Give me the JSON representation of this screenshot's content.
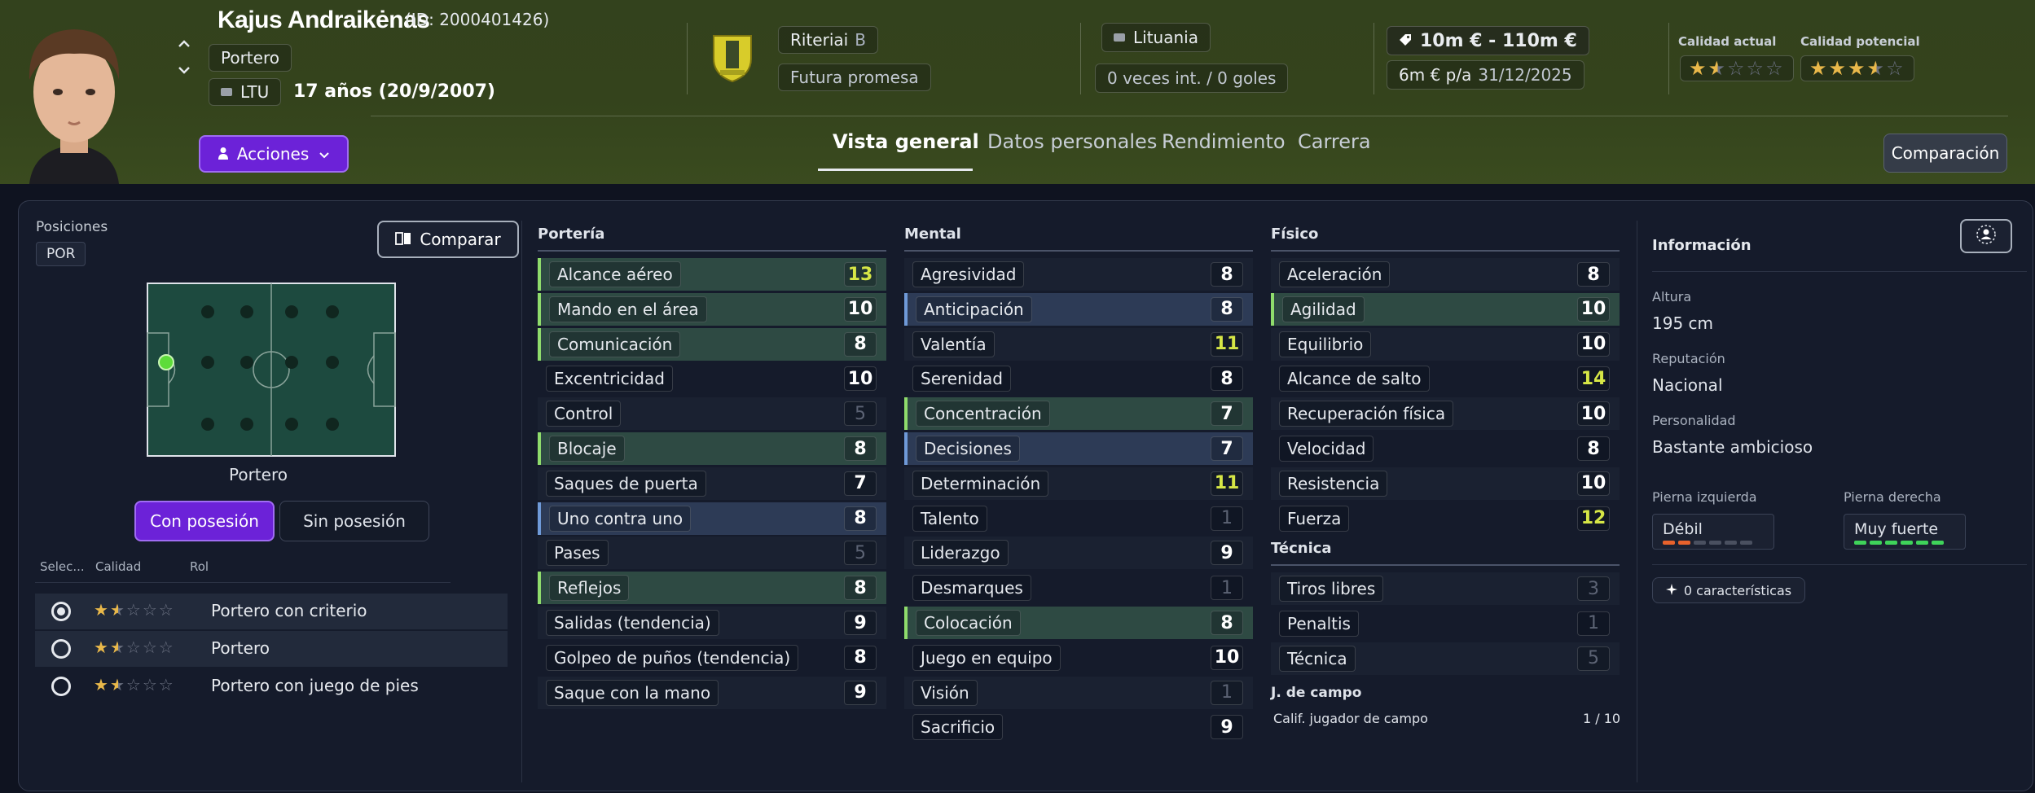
{
  "player": {
    "name": "Kajus Andraikėnas",
    "id": "(ID: 2000401426)",
    "position": "Portero",
    "nation_code": "LTU",
    "age": "17 años (20/9/2007)"
  },
  "club": {
    "name": "Riteriai",
    "team": "B",
    "status": "Futura promesa"
  },
  "nation": {
    "name": "Lituania",
    "caps": "0 veces int. / 0 goles"
  },
  "value": {
    "range": "10m € - 110m €",
    "wage": "6m € p/a",
    "contract_end": "31/12/2025"
  },
  "quality": {
    "current_label": "Calidad actual",
    "potential_label": "Calidad potencial",
    "current_stars": 1.5,
    "potential_stars": 3.5,
    "star_color": "#e9b84a"
  },
  "actions_label": "Acciones",
  "tabs": [
    "Vista general",
    "Datos personales",
    "Rendimiento",
    "Carrera"
  ],
  "compare_label": "Comparación",
  "positions": {
    "title": "Posiciones",
    "code": "POR",
    "compare_button": "Comparar",
    "pitch_caption": "Portero",
    "toggle_on": "Con posesión",
    "toggle_off": "Sin posesión"
  },
  "roles": {
    "headers": [
      "Selec...",
      "Calidad",
      "Rol"
    ],
    "items": [
      {
        "name": "Portero con criterio",
        "stars": 1.5,
        "selected": true
      },
      {
        "name": "Portero",
        "stars": 1.5,
        "selected": false
      },
      {
        "name": "Portero con juego de pies",
        "stars": 1.5,
        "selected": false
      }
    ]
  },
  "porteria": {
    "title": "Portería",
    "attrs": [
      {
        "name": "Alcance aéreo",
        "value": "13",
        "hl": "green",
        "tone": "hi"
      },
      {
        "name": "Mando en el área",
        "value": "10",
        "hl": "green",
        "tone": "normal"
      },
      {
        "name": "Comunicación",
        "value": "8",
        "hl": "green",
        "tone": "normal"
      },
      {
        "name": "Excentricidad",
        "value": "10",
        "hl": "none",
        "tone": "normal"
      },
      {
        "name": "Control",
        "value": "5",
        "hl": "none",
        "tone": "dim"
      },
      {
        "name": "Blocaje",
        "value": "8",
        "hl": "green",
        "tone": "normal"
      },
      {
        "name": "Saques de puerta",
        "value": "7",
        "hl": "none",
        "tone": "normal"
      },
      {
        "name": "Uno contra uno",
        "value": "8",
        "hl": "blue",
        "tone": "normal"
      },
      {
        "name": "Pases",
        "value": "5",
        "hl": "none",
        "tone": "dim"
      },
      {
        "name": "Reflejos",
        "value": "8",
        "hl": "green",
        "tone": "normal"
      },
      {
        "name": "Salidas (tendencia)",
        "value": "9",
        "hl": "none",
        "tone": "normal"
      },
      {
        "name": "Golpeo de puños (tendencia)",
        "value": "8",
        "hl": "none",
        "tone": "normal"
      },
      {
        "name": "Saque con la mano",
        "value": "9",
        "hl": "none",
        "tone": "normal"
      }
    ]
  },
  "mental": {
    "title": "Mental",
    "attrs": [
      {
        "name": "Agresividad",
        "value": "8",
        "hl": "none",
        "tone": "normal"
      },
      {
        "name": "Anticipación",
        "value": "8",
        "hl": "blue",
        "tone": "normal"
      },
      {
        "name": "Valentía",
        "value": "11",
        "hl": "none",
        "tone": "hi"
      },
      {
        "name": "Serenidad",
        "value": "8",
        "hl": "none",
        "tone": "normal"
      },
      {
        "name": "Concentración",
        "value": "7",
        "hl": "green",
        "tone": "normal"
      },
      {
        "name": "Decisiones",
        "value": "7",
        "hl": "blue",
        "tone": "normal"
      },
      {
        "name": "Determinación",
        "value": "11",
        "hl": "none",
        "tone": "hi"
      },
      {
        "name": "Talento",
        "value": "1",
        "hl": "none",
        "tone": "dim"
      },
      {
        "name": "Liderazgo",
        "value": "9",
        "hl": "none",
        "tone": "normal"
      },
      {
        "name": "Desmarques",
        "value": "1",
        "hl": "none",
        "tone": "dim"
      },
      {
        "name": "Colocación",
        "value": "8",
        "hl": "green",
        "tone": "normal"
      },
      {
        "name": "Juego en equipo",
        "value": "10",
        "hl": "none",
        "tone": "normal"
      },
      {
        "name": "Visión",
        "value": "1",
        "hl": "none",
        "tone": "dim"
      },
      {
        "name": "Sacrificio",
        "value": "9",
        "hl": "none",
        "tone": "normal"
      }
    ]
  },
  "fisico": {
    "title": "Físico",
    "attrs": [
      {
        "name": "Aceleración",
        "value": "8",
        "hl": "none",
        "tone": "normal"
      },
      {
        "name": "Agilidad",
        "value": "10",
        "hl": "green",
        "tone": "normal"
      },
      {
        "name": "Equilibrio",
        "value": "10",
        "hl": "none",
        "tone": "normal"
      },
      {
        "name": "Alcance de salto",
        "value": "14",
        "hl": "none",
        "tone": "hi"
      },
      {
        "name": "Recuperación física",
        "value": "10",
        "hl": "none",
        "tone": "normal"
      },
      {
        "name": "Velocidad",
        "value": "8",
        "hl": "none",
        "tone": "normal"
      },
      {
        "name": "Resistencia",
        "value": "10",
        "hl": "none",
        "tone": "normal"
      },
      {
        "name": "Fuerza",
        "value": "12",
        "hl": "none",
        "tone": "hi"
      }
    ]
  },
  "tecnica": {
    "title": "Técnica",
    "attrs": [
      {
        "name": "Tiros libres",
        "value": "3",
        "hl": "none",
        "tone": "dim"
      },
      {
        "name": "Penaltis",
        "value": "1",
        "hl": "none",
        "tone": "dim"
      },
      {
        "name": "Técnica",
        "value": "5",
        "hl": "none",
        "tone": "dim"
      }
    ]
  },
  "jcampo": {
    "title": "J. de campo",
    "label": "Calif. jugador de campo",
    "value": "1 / 10"
  },
  "info": {
    "title": "Información",
    "height_label": "Altura",
    "height": "195 cm",
    "reputation_label": "Reputación",
    "reputation": "Nacional",
    "personality_label": "Personalidad",
    "personality": "Bastante ambicioso",
    "left_foot_label": "Pierna izquierda",
    "left_foot": "Débil",
    "left_foot_level": 2,
    "right_foot_label": "Pierna derecha",
    "right_foot": "Muy fuerte",
    "right_foot_level": 6,
    "traits": "0 características",
    "weak_color": "#e8622c",
    "strong_color": "#3fd35a"
  }
}
